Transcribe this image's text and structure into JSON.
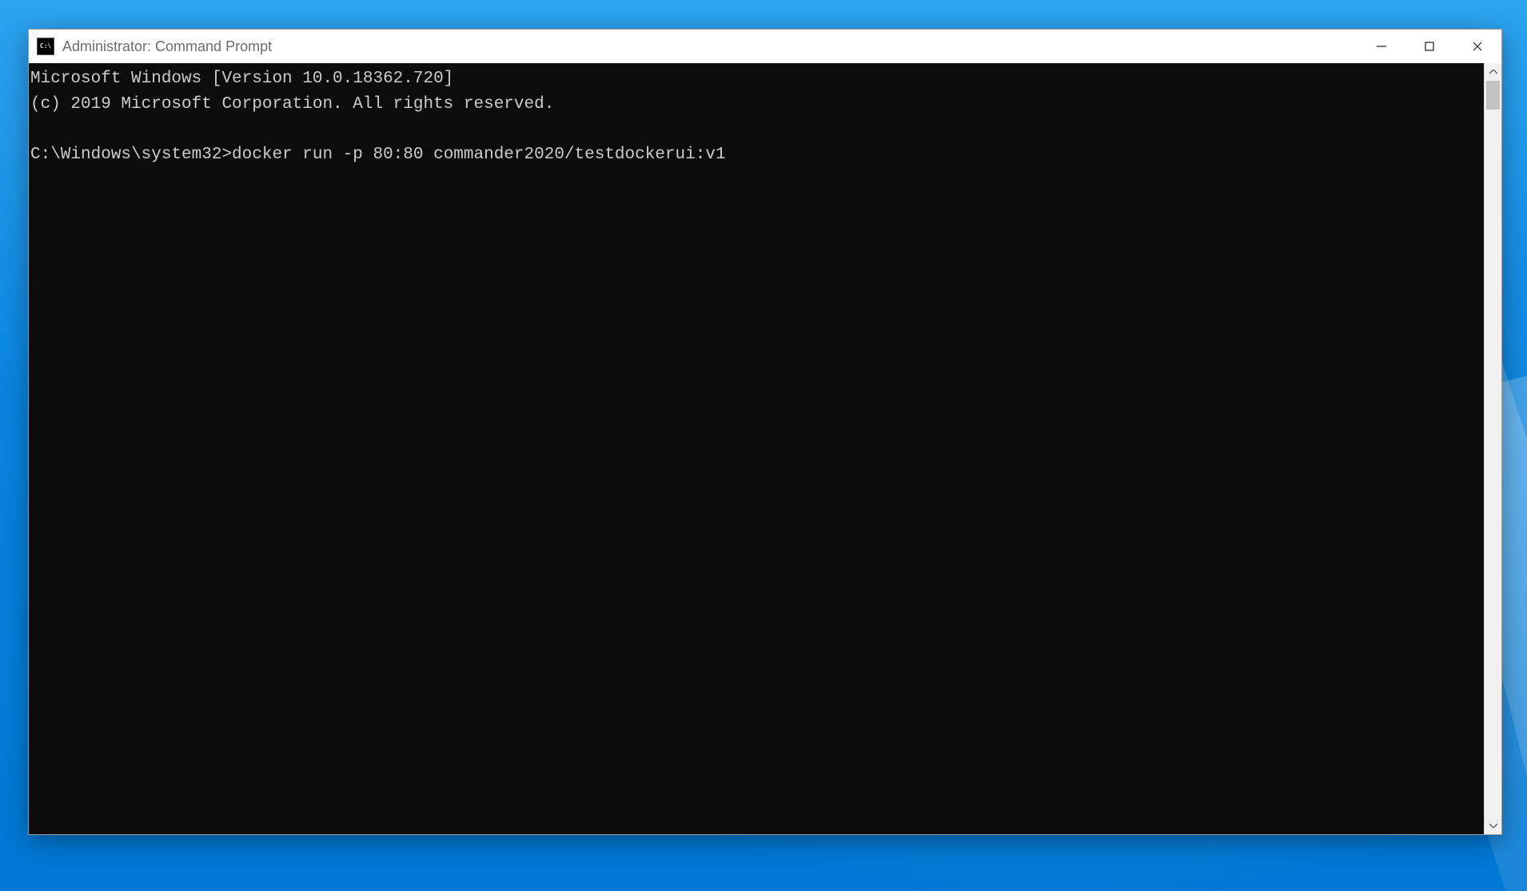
{
  "window": {
    "title": "Administrator: Command Prompt"
  },
  "terminal": {
    "line1": "Microsoft Windows [Version 10.0.18362.720]",
    "line2": "(c) 2019 Microsoft Corporation. All rights reserved.",
    "blank": "",
    "prompt": "C:\\Windows\\system32>",
    "command": "docker run -p 80:80 commander2020/testdockerui:v1"
  }
}
